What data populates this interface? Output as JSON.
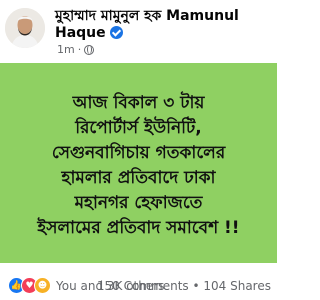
{
  "header": {
    "author_name": "মুহাম্মাদ মামুনুল হক Mamunul Haque",
    "timestamp": "1m",
    "privacy_icon": "globe-icon"
  },
  "card": {
    "lines": [
      "আজ বিকাল ৩ টায়",
      "রিপোর্টার্স ইউনিটি,",
      "সেগুনবাগিচায় গতকালের",
      "হামলার প্রতিবাদে ঢাকা",
      "মহানগর হেফাজতে",
      "ইসলামের প্রতিবাদ সমাবেশ !!"
    ],
    "background_color": "#8fd062"
  },
  "footer": {
    "reactions_label": "You and 3K others",
    "comments": "150 Comments",
    "shares": "104 Shares",
    "separator": "•",
    "reaction_icons": [
      "like-icon",
      "love-icon",
      "haha-icon"
    ]
  }
}
